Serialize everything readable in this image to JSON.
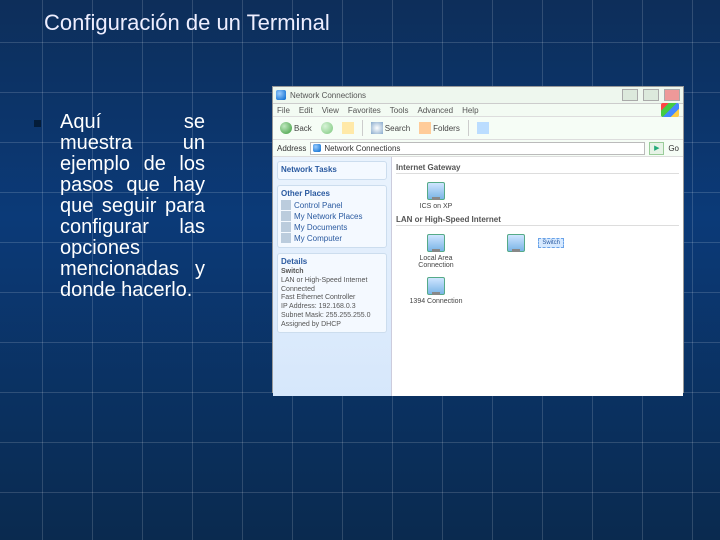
{
  "slide": {
    "title": "Configuración de un Terminal",
    "paragraph": "Aquí se muestra un ejemplo de los pasos que hay que seguir para configurar las opciones mencionadas y donde hacerlo."
  },
  "window": {
    "title": "Network Connections",
    "menu": [
      "File",
      "Edit",
      "View",
      "Favorites",
      "Tools",
      "Advanced",
      "Help"
    ],
    "toolbar": {
      "back": "Back",
      "search": "Search",
      "folders": "Folders"
    },
    "address": {
      "label": "Address",
      "value": "Network Connections",
      "go": "Go"
    },
    "side": {
      "tasks_title": "Network Tasks",
      "other_title": "Other Places",
      "other_items": [
        "Control Panel",
        "My Network Places",
        "My Documents",
        "My Computer"
      ],
      "details_title": "Details",
      "details": {
        "name": "Switch",
        "type": "LAN or High-Speed Internet",
        "status": "Connected",
        "adapter": "Fast Ethernet Controller",
        "ip": "IP Address: 192.168.0.3",
        "mask": "Subnet Mask: 255.255.255.0",
        "dhcp": "Assigned by DHCP"
      }
    },
    "main": {
      "section1": "Internet Gateway",
      "item1": "ICS on XP",
      "section2": "LAN or High-Speed Internet",
      "item2a": "Local Area Connection",
      "item2b": "Switch",
      "item3": "1394 Connection"
    }
  }
}
